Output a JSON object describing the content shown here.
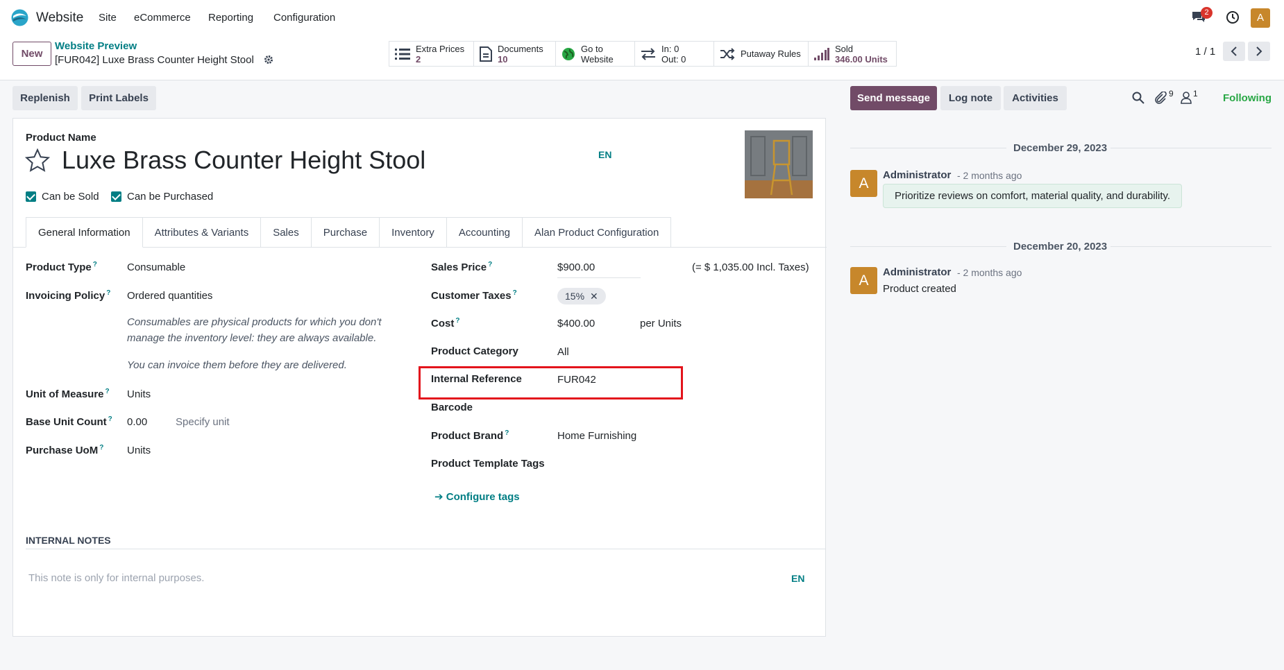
{
  "nav": {
    "app_name": "Website",
    "menus": [
      "Site",
      "eCommerce",
      "Reporting",
      "Configuration"
    ],
    "message_count": "2",
    "user_initial": "A"
  },
  "control_panel": {
    "new_label": "New",
    "breadcrumb_parent": "Website Preview",
    "breadcrumb_current": "[FUR042] Luxe Brass Counter Height Stool",
    "stats": [
      {
        "line1": "Extra Prices",
        "line2": "2",
        "icon": "list-icon"
      },
      {
        "line1": "Documents",
        "line2": "10",
        "icon": "document-icon"
      },
      {
        "line1": "Go to",
        "line2": "Website",
        "icon": "globe-icon"
      },
      {
        "line1": "In: 0",
        "line2": "Out: 0",
        "icon": "transfer-icon"
      },
      {
        "line1": "Putaway Rules",
        "line2": "",
        "icon": "shuffle-icon"
      },
      {
        "line1": "Sold",
        "line2": "346.00 Units",
        "icon": "bar-chart-icon"
      }
    ],
    "pager": "1 / 1"
  },
  "actions": {
    "replenish": "Replenish",
    "print_labels": "Print Labels"
  },
  "chatter_actions": {
    "send_message": "Send message",
    "log_note": "Log note",
    "activities": "Activities",
    "attachment_count": "9",
    "follower_count": "1",
    "following": "Following"
  },
  "product": {
    "name_label": "Product Name",
    "name": "Luxe Brass Counter Height Stool",
    "lang": "EN",
    "can_be_sold": "Can be Sold",
    "can_be_purchased": "Can be Purchased"
  },
  "tabs": [
    "General Information",
    "Attributes & Variants",
    "Sales",
    "Purchase",
    "Inventory",
    "Accounting",
    "Alan Product Configuration"
  ],
  "left_fields": {
    "product_type_label": "Product Type",
    "product_type": "Consumable",
    "invoicing_policy_label": "Invoicing Policy",
    "invoicing_policy": "Ordered quantities",
    "consumable_note_1": "Consumables are physical products for which you don't",
    "consumable_note_2": "manage the inventory level: they are always available.",
    "invoice_note": "You can invoice them before they are delivered.",
    "uom_label": "Unit of Measure",
    "uom": "Units",
    "base_unit_count_label": "Base Unit Count",
    "base_unit_count": "0.00",
    "specify_unit": "Specify unit",
    "purchase_uom_label": "Purchase UoM",
    "purchase_uom": "Units"
  },
  "right_fields": {
    "sales_price_label": "Sales Price",
    "sales_price": "$900.00",
    "incl_taxes": "(= $ 1,035.00 Incl. Taxes)",
    "customer_taxes_label": "Customer Taxes",
    "tax_tag": "15%",
    "cost_label": "Cost",
    "cost": "$400.00",
    "per_units": "per Units",
    "category_label": "Product Category",
    "category": "All",
    "internal_ref_label": "Internal Reference",
    "internal_ref": "FUR042",
    "barcode_label": "Barcode",
    "brand_label": "Product Brand",
    "brand": "Home Furnishing",
    "template_tags_label": "Product Template Tags",
    "configure_tags": "Configure tags"
  },
  "notes": {
    "title": "INTERNAL NOTES",
    "placeholder": "This note is only for internal purposes.",
    "lang": "EN"
  },
  "chatter": {
    "messages": [
      {
        "date": "December 29, 2023",
        "author": "Administrator",
        "ago": "- 2 months ago",
        "body": "Prioritize reviews on comfort, material quality, and durability.",
        "initial": "A"
      },
      {
        "date": "December 20, 2023",
        "author": "Administrator",
        "ago": "- 2 months ago",
        "body": "Product created",
        "initial": "A"
      }
    ]
  },
  "colors": {
    "brand": "#714b67",
    "accent": "#017e84",
    "highlight": "#e3141c"
  }
}
